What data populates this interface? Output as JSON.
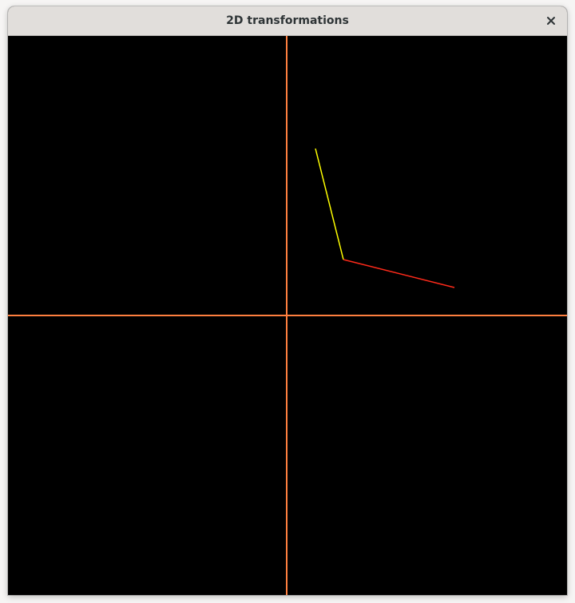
{
  "window": {
    "title": "2D transformations"
  },
  "canvas": {
    "background": "#000000",
    "axes_color": "#ff7f3f",
    "segments": [
      {
        "name": "transformed-x-axis-segment",
        "color": "#ff2a1a"
      },
      {
        "name": "transformed-y-axis-segment",
        "color": "#ffff00"
      }
    ]
  },
  "icons": {
    "close": "close-icon"
  }
}
